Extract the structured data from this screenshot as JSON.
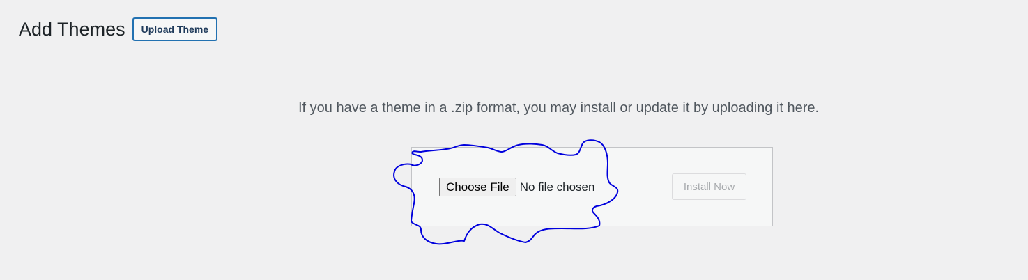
{
  "header": {
    "title": "Add Themes",
    "upload_button_label": "Upload Theme"
  },
  "upload": {
    "instruction": "If you have a theme in a .zip format, you may install or update it by uploading it here.",
    "choose_file_label": "Choose File",
    "file_status": "No file chosen",
    "install_button_label": "Install Now"
  },
  "colors": {
    "background": "#f0f0f1",
    "accent": "#2271b1",
    "annotation": "#0000dd"
  }
}
